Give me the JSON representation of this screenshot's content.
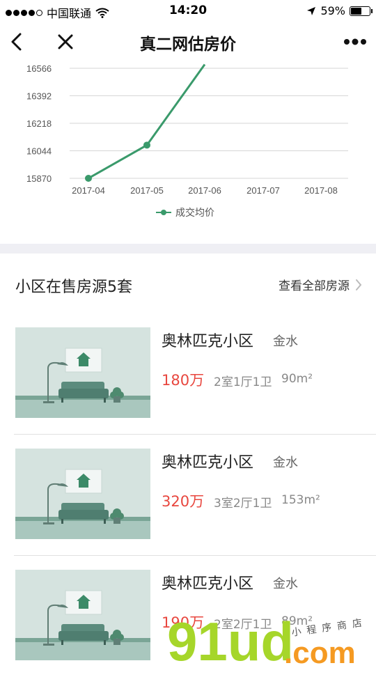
{
  "status_bar": {
    "carrier": "中国联通",
    "time": "14:20",
    "battery": "59%",
    "battery_level": 0.59
  },
  "nav": {
    "title": "真二网估房价",
    "back_icon": "chevron-left-icon",
    "close_icon": "close-icon",
    "more_icon": "more-icon"
  },
  "chart_data": {
    "type": "line",
    "x": [
      "2017-04",
      "2017-05",
      "2017-06",
      "2017-07",
      "2017-08"
    ],
    "y_ticks": [
      15870,
      16044,
      16218,
      16392,
      16566
    ],
    "ylim": [
      15870,
      16566
    ],
    "series": [
      {
        "name": "成交均价",
        "values": [
          15870,
          16080,
          16590,
          null,
          null
        ],
        "color": "#3a9a6b"
      }
    ],
    "grid": true,
    "legend": "bottom-center"
  },
  "section": {
    "title": "小区在售房源5套",
    "link": "查看全部房源"
  },
  "listings": [
    {
      "name": "奥林匹克小区",
      "area": "金水",
      "price": "180万",
      "layout": "2室1厅1卫",
      "size": "90m²"
    },
    {
      "name": "奥林匹克小区",
      "area": "金水",
      "price": "320万",
      "layout": "3室2厅1卫",
      "size": "153m²"
    },
    {
      "name": "奥林匹克小区",
      "area": "金水",
      "price": "190万",
      "layout": "2室2厅1卫",
      "size": "89m²"
    }
  ],
  "watermark": {
    "brand": "91ud",
    "domain": ".com",
    "tagline": "小程序商店"
  }
}
